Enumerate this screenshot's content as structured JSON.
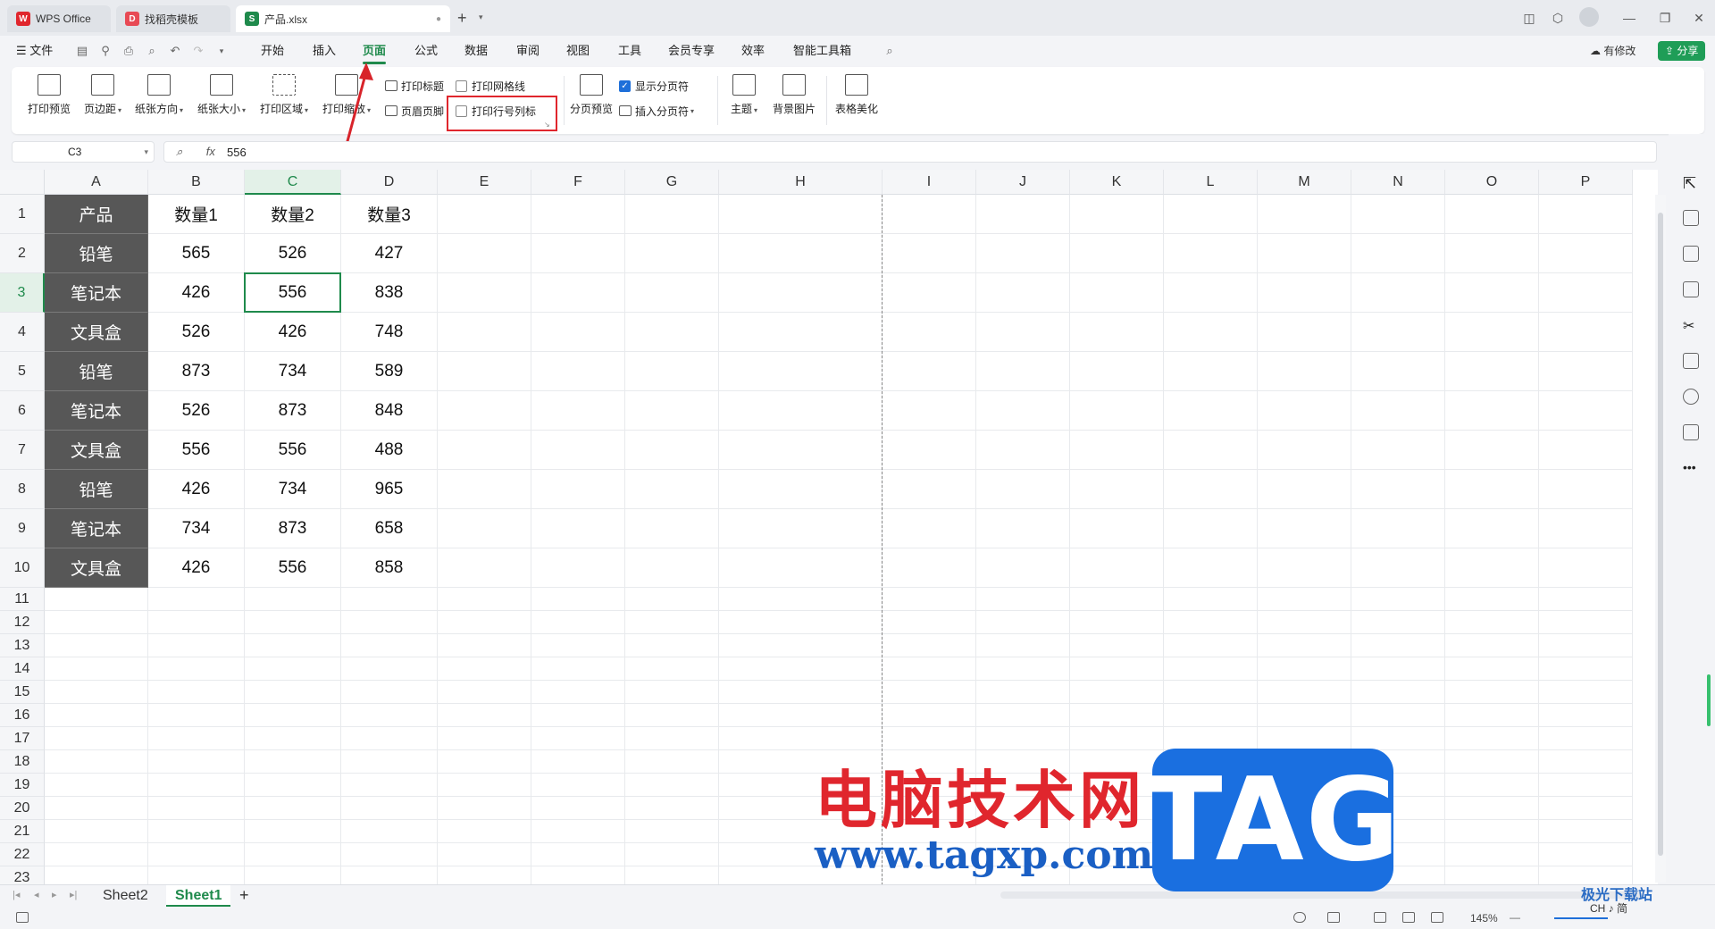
{
  "titlebar": {
    "tabs": [
      {
        "label": "WPS Office",
        "icon": "wps-logo-icon"
      },
      {
        "label": "找稻壳模板",
        "icon": "docer-icon"
      },
      {
        "label": "产品.xlsx",
        "icon": "spreadsheet-icon"
      }
    ],
    "new_tab": "+"
  },
  "menubar": {
    "file_label": "文件",
    "items": [
      "开始",
      "插入",
      "页面",
      "公式",
      "数据",
      "审阅",
      "视图",
      "工具",
      "会员专享",
      "效率",
      "智能工具箱"
    ],
    "active_item": "页面",
    "modified_label": "有修改",
    "share_label": "分享"
  },
  "ribbon": {
    "print_preview": "打印预览",
    "margins": "页边距",
    "orientation": "纸张方向",
    "paper_size": "纸张大小",
    "print_area": "打印区域",
    "print_scale": "打印缩放",
    "print_titles": "打印标题",
    "header_footer": "页眉页脚",
    "print_gridlines": "打印网格线",
    "print_row_col_headers": "打印行号列标",
    "page_break_preview": "分页预览",
    "show_page_breaks": "显示分页符",
    "insert_page_break": "插入分页符",
    "theme": "主题",
    "background_image": "背景图片",
    "table_beautify": "表格美化",
    "checks": {
      "print_gridlines": false,
      "print_row_col_headers": false,
      "show_page_breaks": true
    }
  },
  "formula_bar": {
    "name_box": "C3",
    "fx": "fx",
    "value": "556"
  },
  "grid": {
    "columns": [
      "A",
      "B",
      "C",
      "D",
      "E",
      "F",
      "G",
      "H",
      "I",
      "J",
      "K",
      "L",
      "M",
      "N",
      "O",
      "P"
    ],
    "rows": [
      "1",
      "2",
      "3",
      "4",
      "5",
      "6",
      "7",
      "8",
      "9",
      "10",
      "11",
      "12",
      "13",
      "14",
      "15",
      "16",
      "17",
      "18",
      "19",
      "20",
      "21",
      "22",
      "23"
    ],
    "header": [
      "产品",
      "数量1",
      "数量2",
      "数量3"
    ],
    "data": [
      [
        "铅笔",
        "565",
        "526",
        "427"
      ],
      [
        "笔记本",
        "426",
        "556",
        "838"
      ],
      [
        "文具盒",
        "526",
        "426",
        "748"
      ],
      [
        "铅笔",
        "873",
        "734",
        "589"
      ],
      [
        "笔记本",
        "526",
        "873",
        "848"
      ],
      [
        "文具盒",
        "556",
        "556",
        "488"
      ],
      [
        "铅笔",
        "426",
        "734",
        "965"
      ],
      [
        "笔记本",
        "734",
        "873",
        "658"
      ],
      [
        "文具盒",
        "426",
        "556",
        "858"
      ]
    ],
    "selected_cell": "C3"
  },
  "sheets": {
    "tabs": [
      "Sheet2",
      "Sheet1"
    ],
    "active": "Sheet1",
    "add": "+"
  },
  "statusbar": {
    "zoom": "145%"
  },
  "watermark": {
    "cn": "电脑技术网",
    "url": "www.tagxp.com",
    "tag": "TAG",
    "corner": "极光下载站",
    "ime": "CH ♪ 简"
  },
  "colors": {
    "accent_green": "#1f8a4c",
    "highlight_red": "#e0262d",
    "dark_cell": "#575757"
  }
}
